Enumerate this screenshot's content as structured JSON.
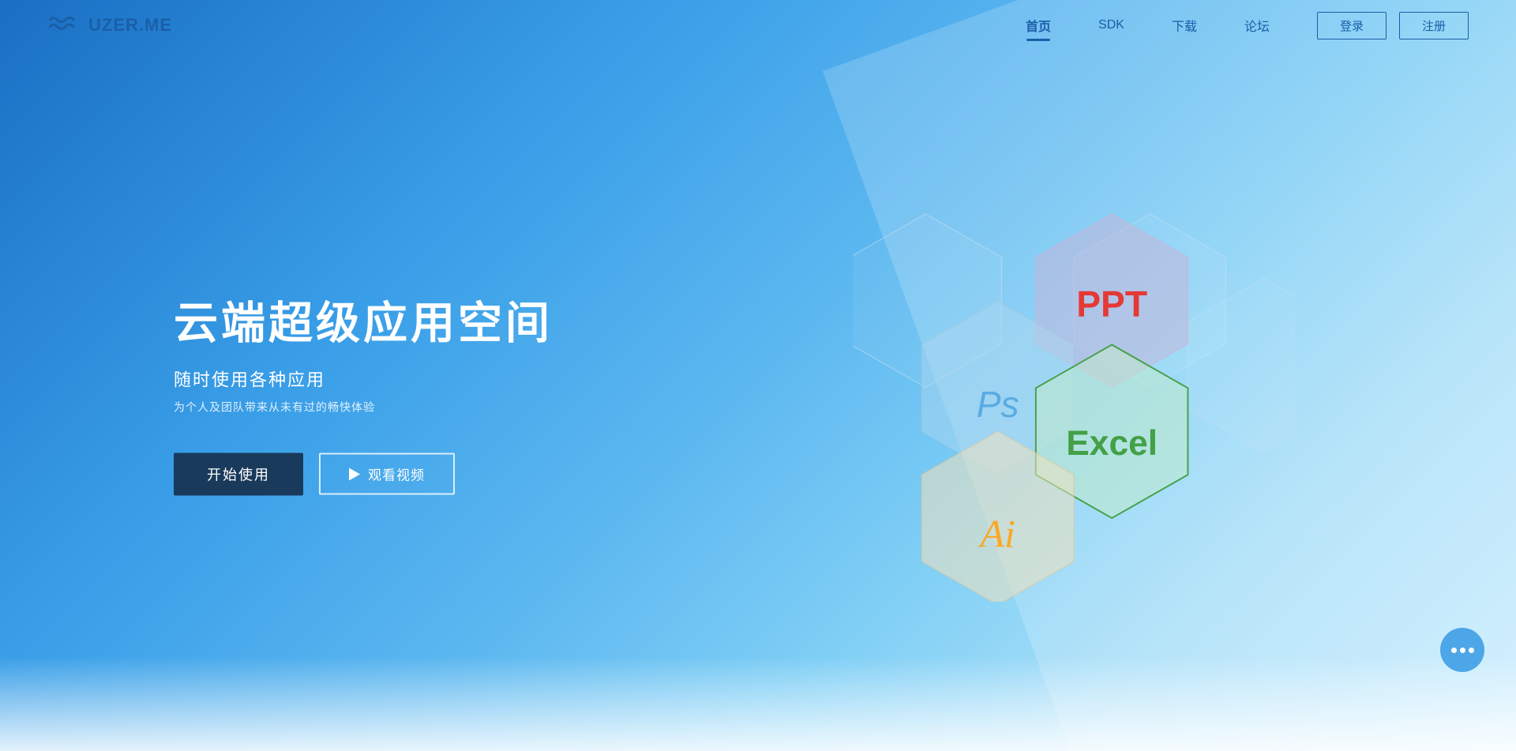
{
  "brand": {
    "name": "UZER.ME"
  },
  "navbar": {
    "links": [
      {
        "label": "首页",
        "active": true
      },
      {
        "label": "SDK",
        "active": false
      },
      {
        "label": "下载",
        "active": false
      },
      {
        "label": "论坛",
        "active": false
      }
    ],
    "login_label": "登录",
    "register_label": "注册"
  },
  "hero": {
    "title": "云端超级应用空间",
    "subtitle": "随时使用各种应用",
    "desc": "为个人及团队带来从未有过的畅快体验",
    "btn_start": "开始使用",
    "btn_video": "观看视频"
  },
  "hexagons": [
    {
      "label": "PPT",
      "color": "#e53935",
      "bg": "rgba(200,180,210,0.5)",
      "stroke": "rgba(200,180,220,0.6)"
    },
    {
      "label": "Ps",
      "color": "#5aa8d8",
      "bg": "rgba(180,215,240,0.45)",
      "stroke": "rgba(160,200,230,0.6)"
    },
    {
      "label": "Excel",
      "color": "#43a047",
      "bg": "rgba(195,230,200,0.5)",
      "stroke": "#43a047"
    },
    {
      "label": "Ai",
      "color": "#f9a825",
      "bg": "rgba(240,225,190,0.55)",
      "stroke": "rgba(220,200,160,0.6)"
    },
    {
      "label": "",
      "color": "transparent",
      "bg": "rgba(255,255,255,0.08)",
      "stroke": "rgba(200,220,240,0.5)"
    },
    {
      "label": "",
      "color": "transparent",
      "bg": "rgba(255,255,255,0.05)",
      "stroke": "rgba(200,220,240,0.4)"
    }
  ],
  "colors": {
    "accent": "#1a5fa8",
    "hero_bg_start": "#1a6fc4",
    "hero_bg_end": "#cceeff"
  }
}
